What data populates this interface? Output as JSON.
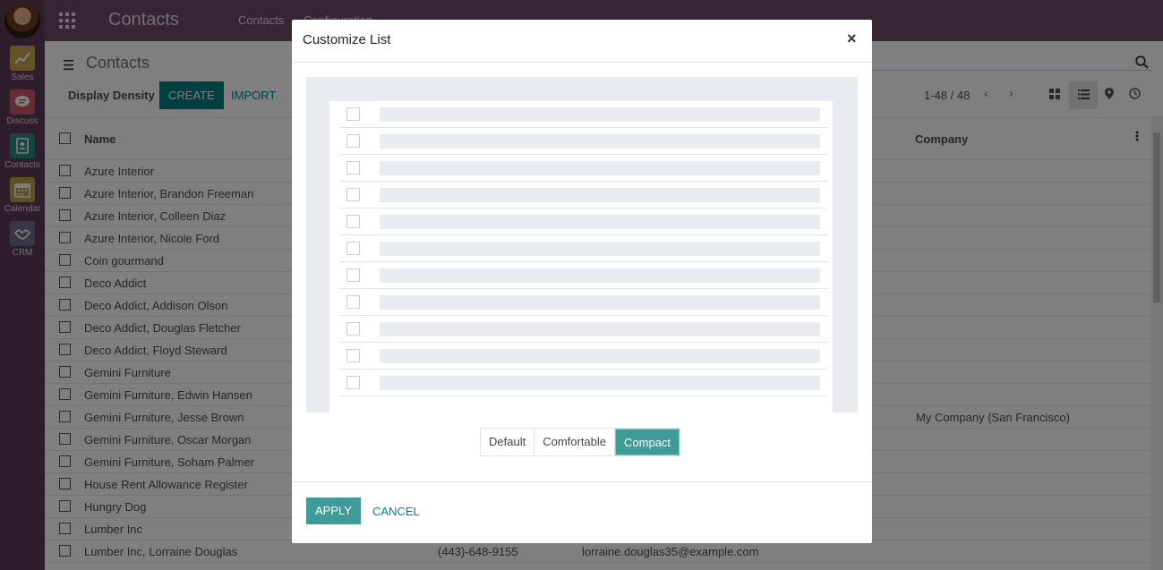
{
  "sidebar": {
    "apps": [
      {
        "label": "Sales",
        "color": "#c8a24a",
        "icon": "chart-line-icon"
      },
      {
        "label": "Discuss",
        "color": "#c95b6b",
        "icon": "chat-bubble-icon"
      },
      {
        "label": "Contacts",
        "color": "#2b8a7d",
        "icon": "address-book-icon"
      },
      {
        "label": "Calendar",
        "color": "#b5a34a",
        "icon": "calendar-icon"
      },
      {
        "label": "CRM",
        "color": "#6b6f8a",
        "icon": "handshake-icon"
      }
    ]
  },
  "navbar": {
    "title": "Contacts",
    "menu": [
      "Contacts",
      "Configuration"
    ]
  },
  "control": {
    "breadcrumb": "Contacts",
    "density_label": "Display Density",
    "create_label": "CREATE",
    "import_label": "IMPORT",
    "pager": "1-48 / 48"
  },
  "list": {
    "columns": {
      "name": "Name",
      "company": "Company"
    },
    "rows": [
      {
        "name": "Azure Interior",
        "phone": "",
        "email": "",
        "company": ""
      },
      {
        "name": "Azure Interior, Brandon Freeman",
        "phone": "",
        "email": "",
        "company": ""
      },
      {
        "name": "Azure Interior, Colleen Diaz",
        "phone": "",
        "email": "",
        "company": ""
      },
      {
        "name": "Azure Interior, Nicole Ford",
        "phone": "",
        "email": "",
        "company": ""
      },
      {
        "name": "Coin gourmand",
        "phone": "",
        "email": "",
        "company": ""
      },
      {
        "name": "Deco Addict",
        "phone": "",
        "email": "",
        "company": ""
      },
      {
        "name": "Deco Addict, Addison Olson",
        "phone": "",
        "email": "",
        "company": ""
      },
      {
        "name": "Deco Addict, Douglas Fletcher",
        "phone": "",
        "email": "",
        "company": ""
      },
      {
        "name": "Deco Addict, Floyd Steward",
        "phone": "",
        "email": "",
        "company": ""
      },
      {
        "name": "Gemini Furniture",
        "phone": "",
        "email": "",
        "company": ""
      },
      {
        "name": "Gemini Furniture, Edwin Hansen",
        "phone": "",
        "email": "",
        "company": ""
      },
      {
        "name": "Gemini Furniture, Jesse Brown",
        "phone": "",
        "email": "",
        "company": "My Company (San Francisco)"
      },
      {
        "name": "Gemini Furniture, Oscar Morgan",
        "phone": "",
        "email": "",
        "company": ""
      },
      {
        "name": "Gemini Furniture, Soham Palmer",
        "phone": "",
        "email": "",
        "company": ""
      },
      {
        "name": "House Rent Allowance Register",
        "phone": "",
        "email": "",
        "company": ""
      },
      {
        "name": "Hungry Dog",
        "phone": "",
        "email": "",
        "company": ""
      },
      {
        "name": "Lumber Inc",
        "phone": "",
        "email": "",
        "company": ""
      },
      {
        "name": "Lumber Inc, Lorraine Douglas",
        "phone": "(443)-648-9155",
        "email": "lorraine.douglas35@example.com",
        "company": ""
      }
    ]
  },
  "modal": {
    "title": "Customize List",
    "close": "×",
    "density_options": [
      {
        "label": "Default",
        "active": false
      },
      {
        "label": "Comfortable",
        "active": false
      },
      {
        "label": "Compact",
        "active": true
      }
    ],
    "apply_label": "APPLY",
    "cancel_label": "CANCEL"
  },
  "colors": {
    "brand": "#714b67",
    "primary": "#017e84",
    "active_density": "#3e9b98"
  }
}
